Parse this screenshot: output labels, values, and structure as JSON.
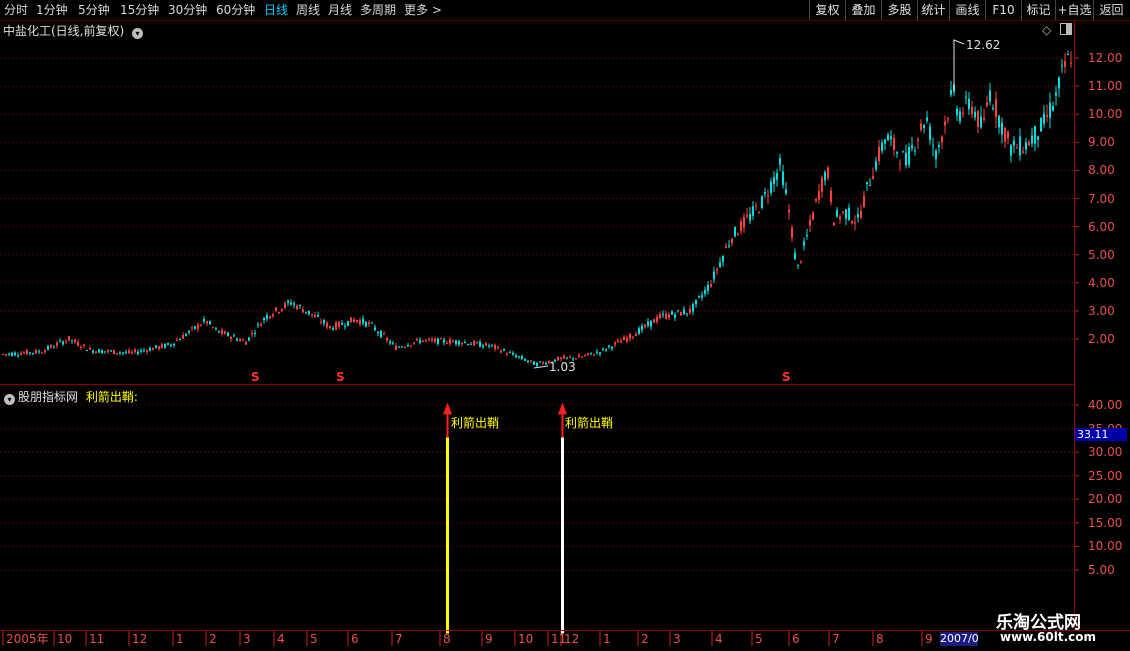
{
  "period_tabs": [
    {
      "label": "分时",
      "active": false
    },
    {
      "label": "1分钟",
      "active": false
    },
    {
      "label": "5分钟",
      "active": false
    },
    {
      "label": "15分钟",
      "active": false
    },
    {
      "label": "30分钟",
      "active": false
    },
    {
      "label": "60分钟",
      "active": false
    },
    {
      "label": "日线",
      "active": true
    },
    {
      "label": "周线",
      "active": false
    },
    {
      "label": "月线",
      "active": false
    },
    {
      "label": "多周期",
      "active": false
    },
    {
      "label": "更多",
      "active": false
    }
  ],
  "more_arrow": ">",
  "toolbar_buttons": [
    "复权",
    "叠加",
    "多股",
    "统计",
    "画线",
    "F10",
    "标记",
    "+自选",
    "返回"
  ],
  "main_title": "中盐化工(日线,前复权)",
  "price_axis": [
    "12.00",
    "11.00",
    "10.00",
    "9.00",
    "8.00",
    "7.00",
    "6.00",
    "5.00",
    "4.00",
    "3.00",
    "2.00"
  ],
  "high_label": "12.62",
  "low_label": "1.03",
  "s_marker": "S",
  "indicator": {
    "source": "股朋指标网",
    "name": "利箭出鞘:"
  },
  "indicator_axis": [
    "40.00",
    "35.00",
    "30.00",
    "25.00",
    "20.00",
    "15.00",
    "10.00",
    "5.00"
  ],
  "current_value": "33.11",
  "signal_label": "利箭出鞘",
  "x_axis": [
    "2005年",
    "10",
    "11",
    "12",
    "1",
    "2",
    "3",
    "4",
    "5",
    "6",
    "7",
    "8",
    "9",
    "10",
    "11",
    "12",
    "1",
    "2",
    "3",
    "4",
    "5",
    "6",
    "7",
    "8",
    "9"
  ],
  "x_axis_date_box": "2007/0",
  "watermark": {
    "title": "乐淘公式网",
    "url": "www.60lt.com"
  },
  "colors": {
    "up": "#ff4040",
    "down": "#00e0e0",
    "grid": "#8b0000",
    "axis_text": "#e85050",
    "signal": "#ffff00",
    "active_tab": "#00ccff"
  }
}
